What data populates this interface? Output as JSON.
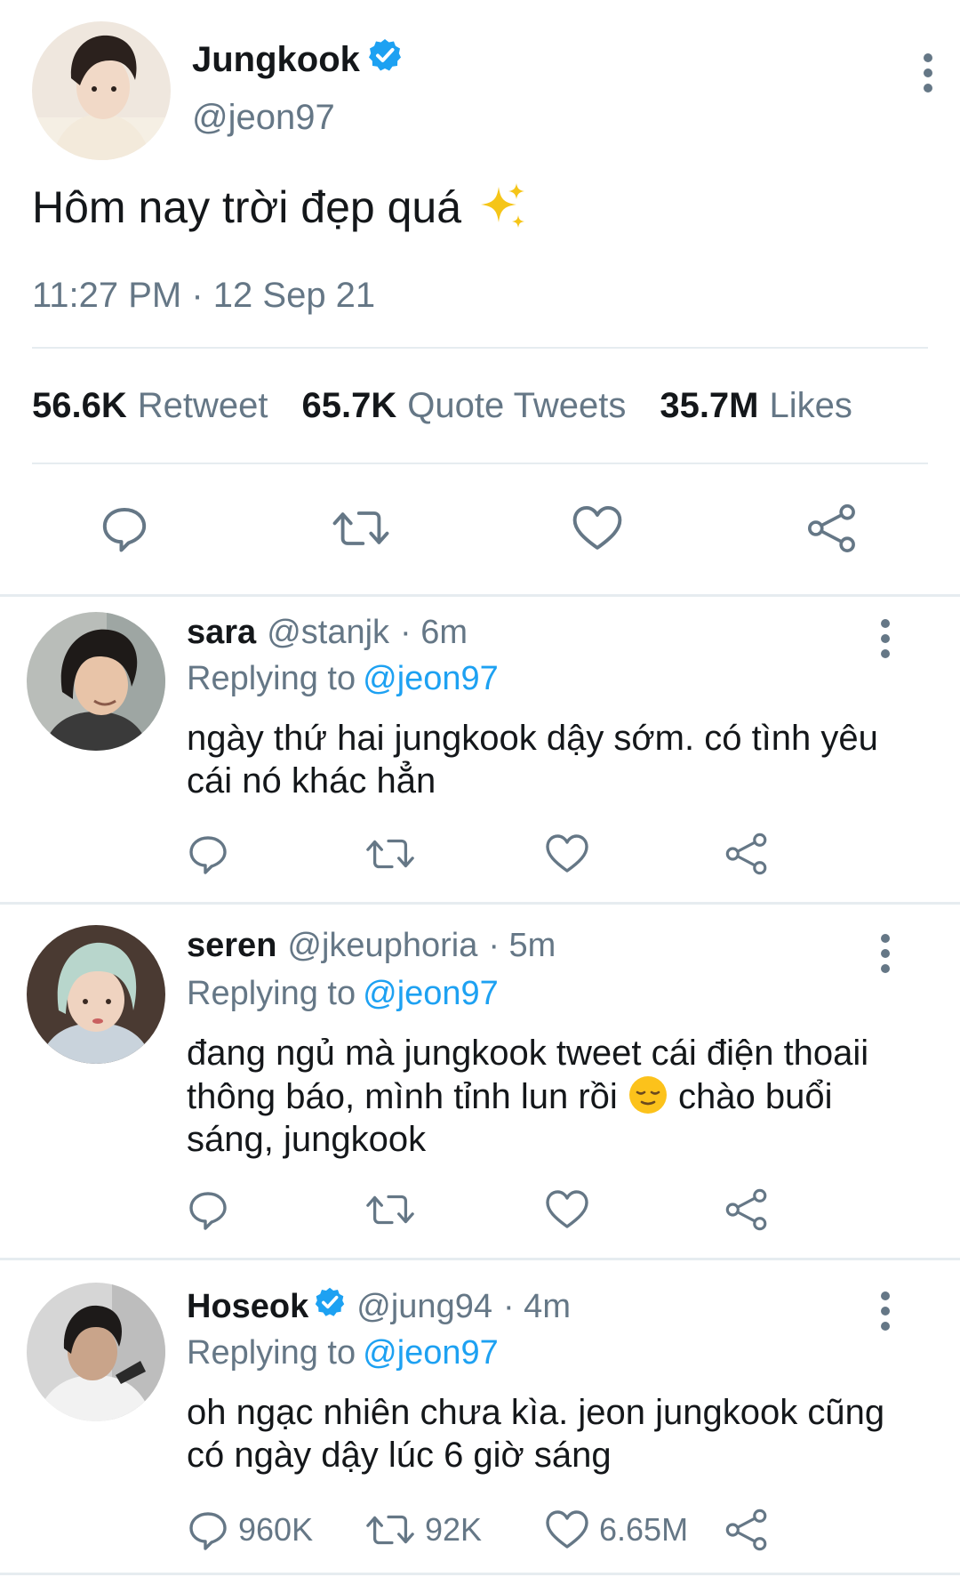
{
  "main_tweet": {
    "name": "Jungkook",
    "handle": "@jeon97",
    "text": "Hôm nay trời đẹp quá",
    "time": "11:27 PM · 12 Sep 21",
    "stats": [
      {
        "value": "56.6K",
        "label": "Retweet"
      },
      {
        "value": "65.7K",
        "label": "Quote Tweets"
      },
      {
        "value": "35.7M",
        "label": "Likes"
      }
    ]
  },
  "replies": [
    {
      "name": "sara",
      "handle": "@stanjk",
      "time": "· 6m",
      "replying_label": "Replying to",
      "replying_handle": "@jeon97",
      "text": "ngày thứ hai jungkook dậy sớm. có tình yêu cái nó khác hẳn"
    },
    {
      "name": "seren",
      "handle": "@jkeuphoria",
      "time": "· 5m",
      "replying_label": "Replying to",
      "replying_handle": "@jeon97",
      "text_before": "đang ngủ mà jungkook tweet cái điện thoaii thông báo, mình tỉnh lun rồi",
      "text_after": "chào buổi sáng, jungkook"
    },
    {
      "name": "Hoseok",
      "handle": "@jung94",
      "time": "· 4m",
      "replying_label": "Replying to",
      "replying_handle": "@jeon97",
      "text": "oh ngạc nhiên chưa kìa. jeon jungkook cũng có ngày dậy lúc 6 giờ sáng",
      "counts": {
        "reply": "960K",
        "retweet": "92K",
        "like": "6.65M"
      }
    }
  ],
  "colors": {
    "accent": "#1da1f2",
    "secondary_text": "#657786",
    "divider": "#e6ecf0"
  },
  "icons": [
    "verified-badge-icon",
    "sparkles-icon",
    "reply-icon",
    "retweet-icon",
    "like-icon",
    "share-icon",
    "more-icon",
    "relieved-face-emoji"
  ]
}
